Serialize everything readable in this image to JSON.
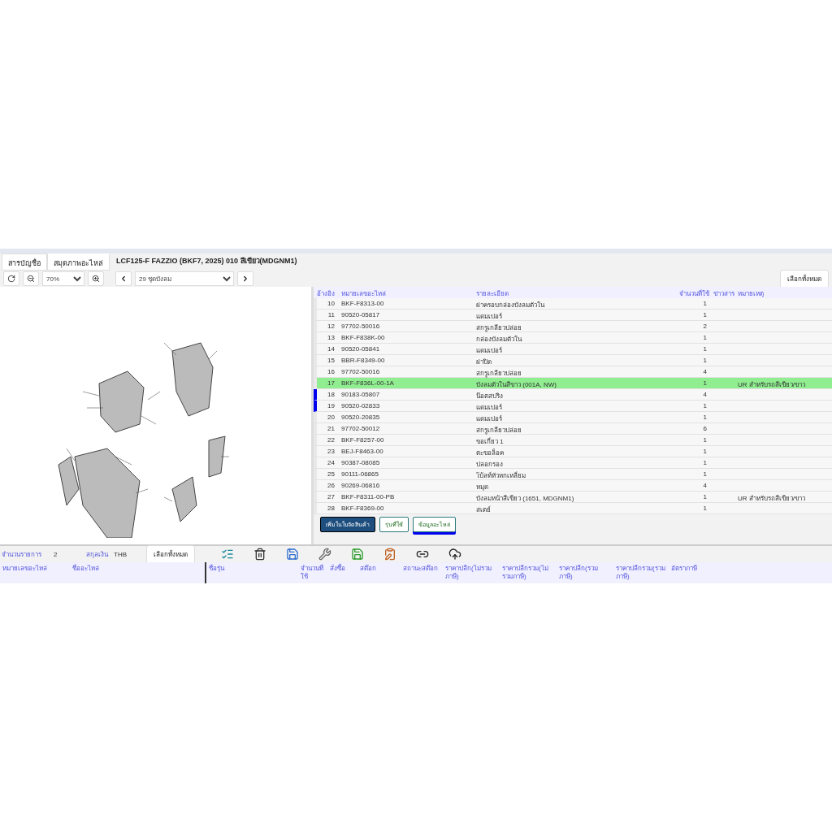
{
  "tabs": [
    {
      "label": "สารบัญชื่อ",
      "selected": false
    },
    {
      "label": "สมุดภาพอะไหล่",
      "selected": true
    }
  ],
  "model_title": "LCF125-F FAZZIO (BKF7, 2025) 010 สีเขียว(MDGNM1)",
  "toolbar": {
    "zoom": "70%",
    "section": "29 ชุดบังลม",
    "select_all": "เลือกทั้งหมด"
  },
  "parts_table": {
    "columns": [
      "อ้างอิง",
      "หมายเลขอะไหล่",
      "รายละเอียด",
      "จำนวนที่ใช้",
      "ข่าวสาร",
      "หมายเหตุ"
    ],
    "rows": [
      {
        "ref": "10",
        "part_no": "BKF-F8313-00",
        "description": "ฝาครอบกล่องบังลมตัวใน",
        "qty": "1",
        "remark": "",
        "selected": false,
        "marked": false
      },
      {
        "ref": "11",
        "part_no": "90520-05817",
        "description": "แดมเปอร์",
        "qty": "1",
        "remark": "",
        "selected": false,
        "marked": false
      },
      {
        "ref": "12",
        "part_no": "97702-50016",
        "description": "สกรูเกลียวปล่อย",
        "qty": "2",
        "remark": "",
        "selected": false,
        "marked": false
      },
      {
        "ref": "13",
        "part_no": "BKF-F838K-00",
        "description": "กล่องบังลมตัวใน",
        "qty": "1",
        "remark": "",
        "selected": false,
        "marked": false
      },
      {
        "ref": "14",
        "part_no": "90520-05841",
        "description": "แดมเปอร์",
        "qty": "1",
        "remark": "",
        "selected": false,
        "marked": false
      },
      {
        "ref": "15",
        "part_no": "BBR-F8349-00",
        "description": "ฝาปิด",
        "qty": "1",
        "remark": "",
        "selected": false,
        "marked": false
      },
      {
        "ref": "16",
        "part_no": "97702-50016",
        "description": "สกรูเกลียวปล่อย",
        "qty": "4",
        "remark": "",
        "selected": false,
        "marked": false
      },
      {
        "ref": "17",
        "part_no": "BKF-F836L-00-1A",
        "description": "บังลมตัวในสีขาว (001A, NW)",
        "qty": "1",
        "remark": "UR สำหรับรถสีเขียว/ขาว",
        "selected": true,
        "marked": false
      },
      {
        "ref": "18",
        "part_no": "90183-05807",
        "description": "น๊อตสปริง",
        "qty": "4",
        "remark": "",
        "selected": false,
        "marked": true
      },
      {
        "ref": "19",
        "part_no": "90520-02833",
        "description": "แดมเปอร์",
        "qty": "1",
        "remark": "",
        "selected": false,
        "marked": true
      },
      {
        "ref": "20",
        "part_no": "90520-20835",
        "description": "แดมเปอร์",
        "qty": "1",
        "remark": "",
        "selected": false,
        "marked": false
      },
      {
        "ref": "21",
        "part_no": "97702-50012",
        "description": "สกรูเกลียวปล่อย",
        "qty": "6",
        "remark": "",
        "selected": false,
        "marked": false
      },
      {
        "ref": "22",
        "part_no": "BKF-F8257-00",
        "description": "ขอเกี่ยว 1",
        "qty": "1",
        "remark": "",
        "selected": false,
        "marked": false
      },
      {
        "ref": "23",
        "part_no": "BEJ-F8463-00",
        "description": "ตะขอล็อค",
        "qty": "1",
        "remark": "",
        "selected": false,
        "marked": false
      },
      {
        "ref": "24",
        "part_no": "90387-08085",
        "description": "ปลอกรอง",
        "qty": "1",
        "remark": "",
        "selected": false,
        "marked": false
      },
      {
        "ref": "25",
        "part_no": "90111-06865",
        "description": "โบ้ลท์หัวหกเหลี่ยม",
        "qty": "1",
        "remark": "",
        "selected": false,
        "marked": false
      },
      {
        "ref": "26",
        "part_no": "90269-06816",
        "description": "หมุด",
        "qty": "4",
        "remark": "",
        "selected": false,
        "marked": false
      },
      {
        "ref": "27",
        "part_no": "BKF-F8311-00-PB",
        "description": "บังลมหน้าสีเขียว (1651, MDGNM1)",
        "qty": "1",
        "remark": "UR สำหรับรถสีเขียว/ขาว",
        "selected": false,
        "marked": false
      },
      {
        "ref": "28",
        "part_no": "BKF-F8369-00",
        "description": "สเตย์",
        "qty": "1",
        "remark": "",
        "selected": false,
        "marked": false
      }
    ]
  },
  "actions": [
    {
      "label": "เพิ่มในใบจัดสินค้า",
      "kind": "primary",
      "selected": false
    },
    {
      "label": "รุ่นที่ใช้",
      "kind": "tab",
      "selected": false
    },
    {
      "label": "ข้อมูลอะไหล่",
      "kind": "tab",
      "selected": true
    }
  ],
  "cart_bar": {
    "count_label": "จำนวนรายการ",
    "count": "2",
    "currency_label": "สกุลเงิน",
    "currency": "THB",
    "select_all": "เลือกทั้งหมด"
  },
  "cart_columns": [
    "หมายเลขอะไหล่",
    "ชื่ออะไหล่",
    "ชื่อรุ่น",
    "จำนวนที่ใช้",
    "สั่งซื้อ",
    "สต๊อก",
    "สถานะสต๊อก",
    "ราคาปลีก(ไม่รวมภาษี)",
    "ราคาปลีกรวม(ไม่รวมภาษี)",
    "ราคาปลีก(รวมภาษี)",
    "ราคาปลีกรวม(รวมภาษี)",
    "อัตราภาษี"
  ]
}
